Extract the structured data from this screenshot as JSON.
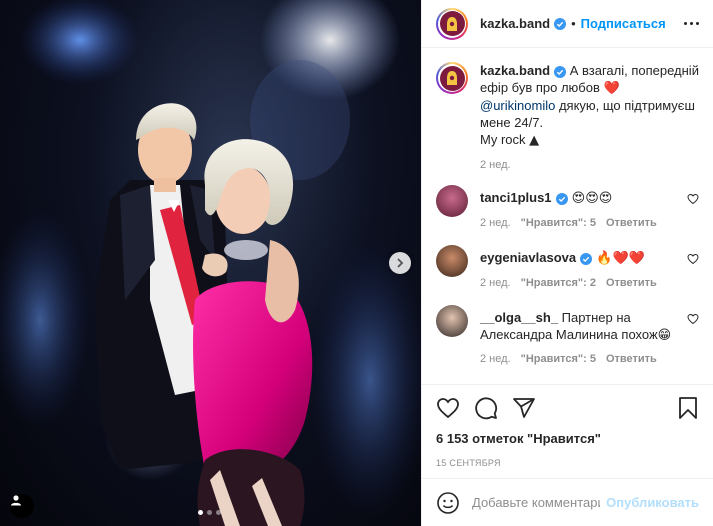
{
  "post": {
    "image_alt": "",
    "carousel": {
      "count": 3,
      "active_index": 0
    }
  },
  "header": {
    "username": "kazka.band",
    "separator": "•",
    "follow_label": "Подписаться"
  },
  "caption": {
    "username": "kazka.band",
    "text_1": " А взагалі, попередній ефір був про любов ",
    "emoji_1": "❤️",
    "mention": "@urikinomilo",
    "text_2": " дякую, що підтримуєш мене 24/7.",
    "text_3": "My rock ",
    "emoji_2": "▲",
    "time": "2 нед."
  },
  "comments": [
    {
      "username": "tanci1plus1",
      "text": " 😍😍😍",
      "time": "2 нед.",
      "likes": "\"Нравится\": 5",
      "reply": "Ответить"
    },
    {
      "username": "eygeniavlasova",
      "text": " 🔥❤️❤️",
      "time": "2 нед.",
      "likes": "\"Нравится\": 2",
      "reply": "Ответить"
    },
    {
      "username": "__olga__sh_",
      "text": " Партнер на Александра Малинина похож😁",
      "time": "2 нед.",
      "likes": "\"Нравится\": 5",
      "reply": "Ответить"
    }
  ],
  "actions": {
    "likes_text": "6 153 отметок \"Нравится\"",
    "date": "15 СЕНТЯБРЯ"
  },
  "add_comment": {
    "placeholder": "Добавьте комментарий...",
    "post_label": "Опубликовать"
  },
  "colors": {
    "accent": "#0095f6",
    "verified": "#3897f0",
    "like_red": "#ed4956"
  }
}
